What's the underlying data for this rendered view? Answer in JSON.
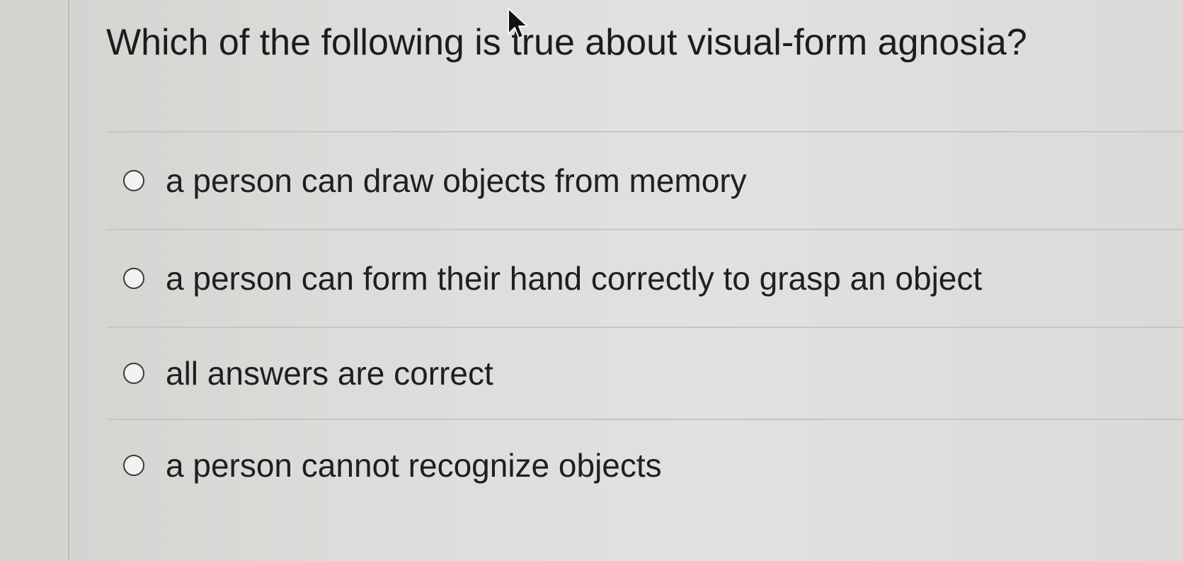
{
  "question": {
    "text": "Which of the following is true about visual-form agnosia?"
  },
  "answers": [
    {
      "label": "a person can draw objects from memory",
      "selected": false
    },
    {
      "label": "a person can form their hand correctly to grasp an object",
      "selected": false
    },
    {
      "label": "all answers are correct",
      "selected": false
    },
    {
      "label": "a person cannot recognize objects",
      "selected": false
    }
  ],
  "icons": {
    "radio": "radio-button-icon",
    "cursor": "mouse-pointer-icon"
  }
}
